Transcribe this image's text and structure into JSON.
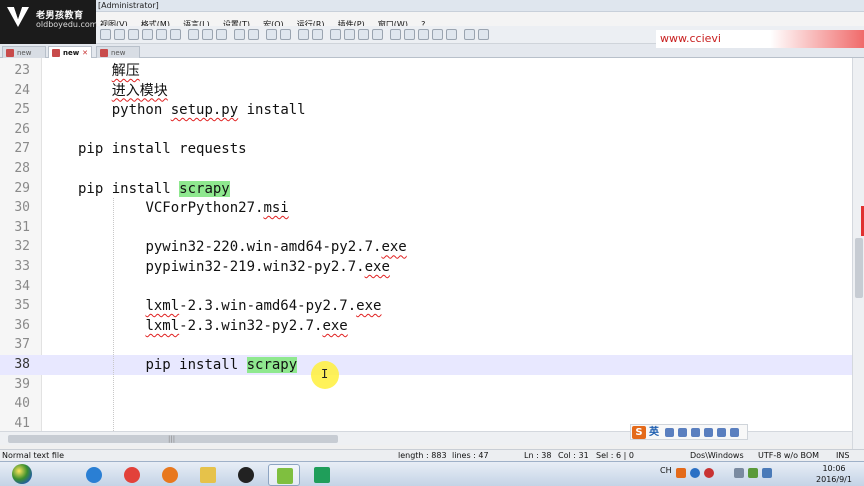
{
  "window": {
    "title": "[Administrator]"
  },
  "logo": {
    "brand": "老男孩教育",
    "domain": "oldboyedu.com"
  },
  "watermark": {
    "text": "www.ccievi"
  },
  "menu": [
    "视图(V)",
    "格式(M)",
    "语言(L)",
    "设置(T)",
    "宏(O)",
    "运行(R)",
    "插件(P)",
    "窗口(W)",
    "?"
  ],
  "tabs": [
    {
      "label": "new",
      "active": false
    },
    {
      "label": "new",
      "active": true
    },
    {
      "label": "new",
      "active": false
    }
  ],
  "editor": {
    "current_line": 38,
    "lines": [
      {
        "num": "23",
        "indent": 4,
        "parts": [
          {
            "text": "解压",
            "style": "squiggle"
          }
        ]
      },
      {
        "num": "24",
        "indent": 4,
        "parts": [
          {
            "text": "进入模块",
            "style": "squiggle"
          }
        ]
      },
      {
        "num": "25",
        "indent": 4,
        "parts": [
          {
            "text": "python ",
            "style": ""
          },
          {
            "text": "setup.py",
            "style": "squiggle"
          },
          {
            "text": " install",
            "style": ""
          }
        ]
      },
      {
        "num": "26",
        "indent": 0,
        "parts": []
      },
      {
        "num": "27",
        "indent": 0,
        "parts": [
          {
            "text": "pip install requests",
            "style": ""
          }
        ]
      },
      {
        "num": "28",
        "indent": 0,
        "parts": []
      },
      {
        "num": "29",
        "indent": 0,
        "parts": [
          {
            "text": "pip install ",
            "style": ""
          },
          {
            "text": "scrapy",
            "style": "highlight"
          }
        ]
      },
      {
        "num": "30",
        "indent": 8,
        "parts": [
          {
            "text": "VCForPython27.",
            "style": ""
          },
          {
            "text": "msi",
            "style": "squiggle"
          }
        ]
      },
      {
        "num": "31",
        "indent": 0,
        "parts": []
      },
      {
        "num": "32",
        "indent": 8,
        "parts": [
          {
            "text": "pywin32-220.win-amd64-py2.7.",
            "style": ""
          },
          {
            "text": "exe",
            "style": "squiggle"
          }
        ]
      },
      {
        "num": "33",
        "indent": 8,
        "parts": [
          {
            "text": "pypiwin32-219.win32-py2.7.",
            "style": ""
          },
          {
            "text": "exe",
            "style": "squiggle"
          }
        ]
      },
      {
        "num": "34",
        "indent": 0,
        "parts": []
      },
      {
        "num": "35",
        "indent": 8,
        "parts": [
          {
            "text": "lxml",
            "style": "squiggle"
          },
          {
            "text": "-2.3.win-amd64-py2.7.",
            "style": ""
          },
          {
            "text": "exe",
            "style": "squiggle"
          }
        ]
      },
      {
        "num": "36",
        "indent": 8,
        "parts": [
          {
            "text": "lxml",
            "style": "squiggle"
          },
          {
            "text": "-2.3.win32-py2.7.",
            "style": ""
          },
          {
            "text": "exe",
            "style": "squiggle"
          }
        ]
      },
      {
        "num": "37",
        "indent": 0,
        "parts": []
      },
      {
        "num": "38",
        "indent": 8,
        "parts": [
          {
            "text": "pip install ",
            "style": ""
          },
          {
            "text": "scrapy",
            "style": "highlight"
          }
        ]
      },
      {
        "num": "39",
        "indent": 0,
        "parts": []
      },
      {
        "num": "40",
        "indent": 0,
        "parts": []
      },
      {
        "num": "41",
        "indent": 0,
        "parts": []
      }
    ]
  },
  "ime": {
    "logo": "S",
    "lang": "英"
  },
  "status": {
    "file_type": "Normal text file",
    "length": "length : 883",
    "lines": "lines : 47",
    "ln": "Ln : 38",
    "col": "Col : 31",
    "sel": "Sel : 6 | 0",
    "eol": "Dos\\Windows",
    "encoding": "UTF-8 w/o BOM",
    "mode": "INS"
  },
  "taskbar": {
    "apps": [
      {
        "name": "ie",
        "color": "#2a7fd4"
      },
      {
        "name": "chrome",
        "color": "#e2413a"
      },
      {
        "name": "firefox",
        "color": "#e8781e"
      },
      {
        "name": "explorer",
        "color": "#e6c24a"
      },
      {
        "name": "qq",
        "color": "#222222"
      },
      {
        "name": "notepad-plus-plus",
        "color": "#7fbf3f"
      },
      {
        "name": "pycharm",
        "color": "#1f9e5a"
      }
    ],
    "tray_lang": "CH",
    "clock_time": "10:06",
    "clock_date": "2016/9/1"
  }
}
